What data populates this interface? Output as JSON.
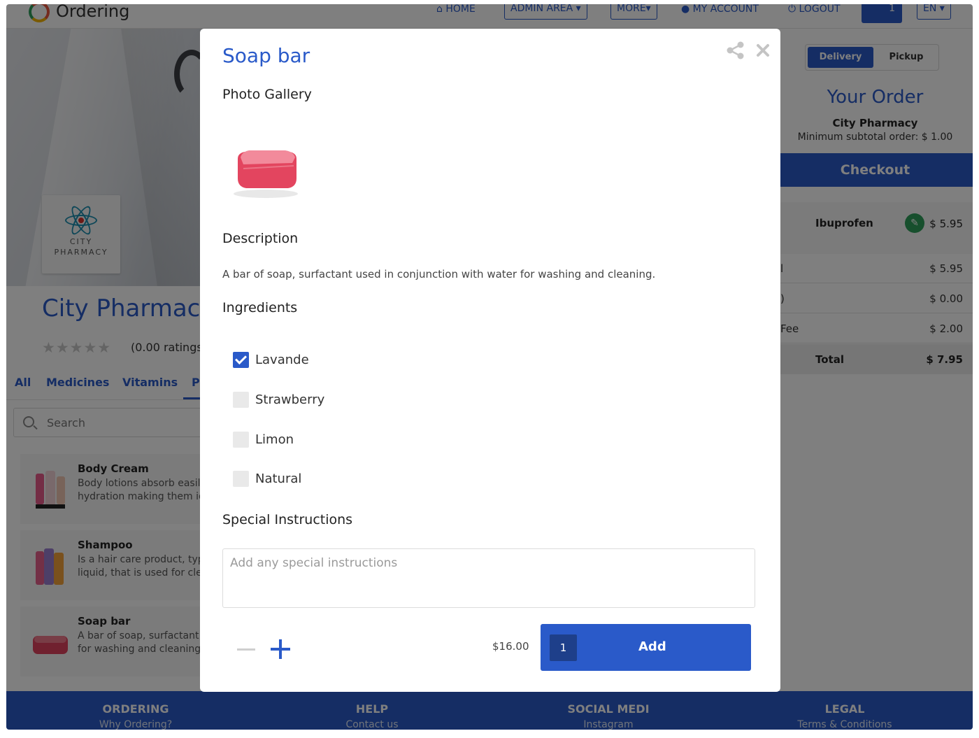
{
  "nav": {
    "logo_text": "Ordering",
    "home": "HOME",
    "admin_area": "ADMIN AREA",
    "more": "MORE",
    "my_account": "MY ACCOUNT",
    "logout": "LOGOUT",
    "cart_count": "1",
    "language": "EN"
  },
  "store": {
    "logo_line1": "CITY",
    "logo_line2": "PHARMACY",
    "name": "City Pharmacy",
    "ratings": "(0.00 ratings)",
    "categories": [
      "All",
      "Medicines",
      "Vitamins",
      "Pe"
    ],
    "search_placeholder": "Search",
    "products": [
      {
        "title": "Body Cream",
        "desc1": "Body lotions absorb easily",
        "desc2": "hydration making them ide"
      },
      {
        "title": "Shampoo",
        "desc1": "Is a hair care product, typ",
        "desc2": "liquid, that is used for clea"
      },
      {
        "title": "Soap bar",
        "desc1": "A bar of soap, surfactant",
        "desc2": "for washing and cleaning"
      }
    ]
  },
  "order": {
    "delivery": "Delivery",
    "pickup": "Pickup",
    "title": "Your Order",
    "store": "City Pharmacy",
    "minimum": "Minimum subtotal order: $ 1.00",
    "checkout": "Checkout",
    "item_name": "Ibuprofen",
    "item_price": "$ 5.95",
    "rows": [
      {
        "label": "l",
        "value": "$ 5.95"
      },
      {
        "label": ")",
        "value": "$ 0.00"
      },
      {
        "label": "Fee",
        "value": "$ 2.00"
      }
    ],
    "total_label": "Total",
    "total_value": "$ 7.95"
  },
  "footer": {
    "cols": [
      {
        "title": "ORDERING",
        "link": "Why Ordering?"
      },
      {
        "title": "HELP",
        "link": "Contact us"
      },
      {
        "title": "SOCIAL MEDI",
        "link": "Instagram"
      },
      {
        "title": "LEGAL",
        "link": "Terms & Conditions"
      }
    ]
  },
  "modal": {
    "title": "Soap bar",
    "photo_gallery": "Photo Gallery",
    "description_heading": "Description",
    "description": "A bar of soap, surfactant used in conjunction with water for washing and cleaning.",
    "ingredients_heading": "Ingredients",
    "ingredients": [
      {
        "label": "Lavande",
        "checked": true
      },
      {
        "label": "Strawberry",
        "checked": false
      },
      {
        "label": "Limon",
        "checked": false
      },
      {
        "label": "Natural",
        "checked": false
      }
    ],
    "special_heading": "Special Instructions",
    "special_placeholder": "Add any special instructions",
    "price": "$16.00",
    "quantity": "1",
    "add_label": "Add"
  },
  "colors": {
    "accent": "#2a5ac9",
    "success": "#2f9e5b"
  }
}
